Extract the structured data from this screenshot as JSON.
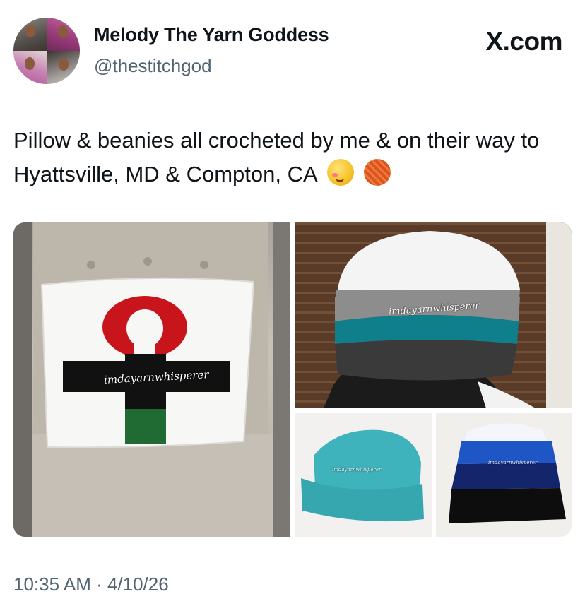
{
  "post": {
    "author_name": "Melody The Yarn Goddess",
    "author_handle": "@thestitchgod",
    "brand": "X.com",
    "text": "Pillow & beanies all crocheted by me & on their way to Hyattsville, MD & Compton, CA",
    "emojis": [
      "smiling-face-with-hearts",
      "ball-of-yarn"
    ],
    "timestamp": "10:35 AM · 4/10/26"
  },
  "media": {
    "watermark": "imdayarnwhisperer",
    "colors": {
      "pillow": "#f7f7f5",
      "ankh_red": "#c8151b",
      "ankh_black": "#111111",
      "ankh_green": "#1f6b33",
      "hat_teal": "#0f7f8c",
      "hat_gray": "#8d8d8d",
      "hat_charcoal": "#3a3a3a",
      "beanie_aqua": "#3fb3bb",
      "beanie_blue": "#1f56c6",
      "beanie_navy": "#15256b"
    }
  }
}
